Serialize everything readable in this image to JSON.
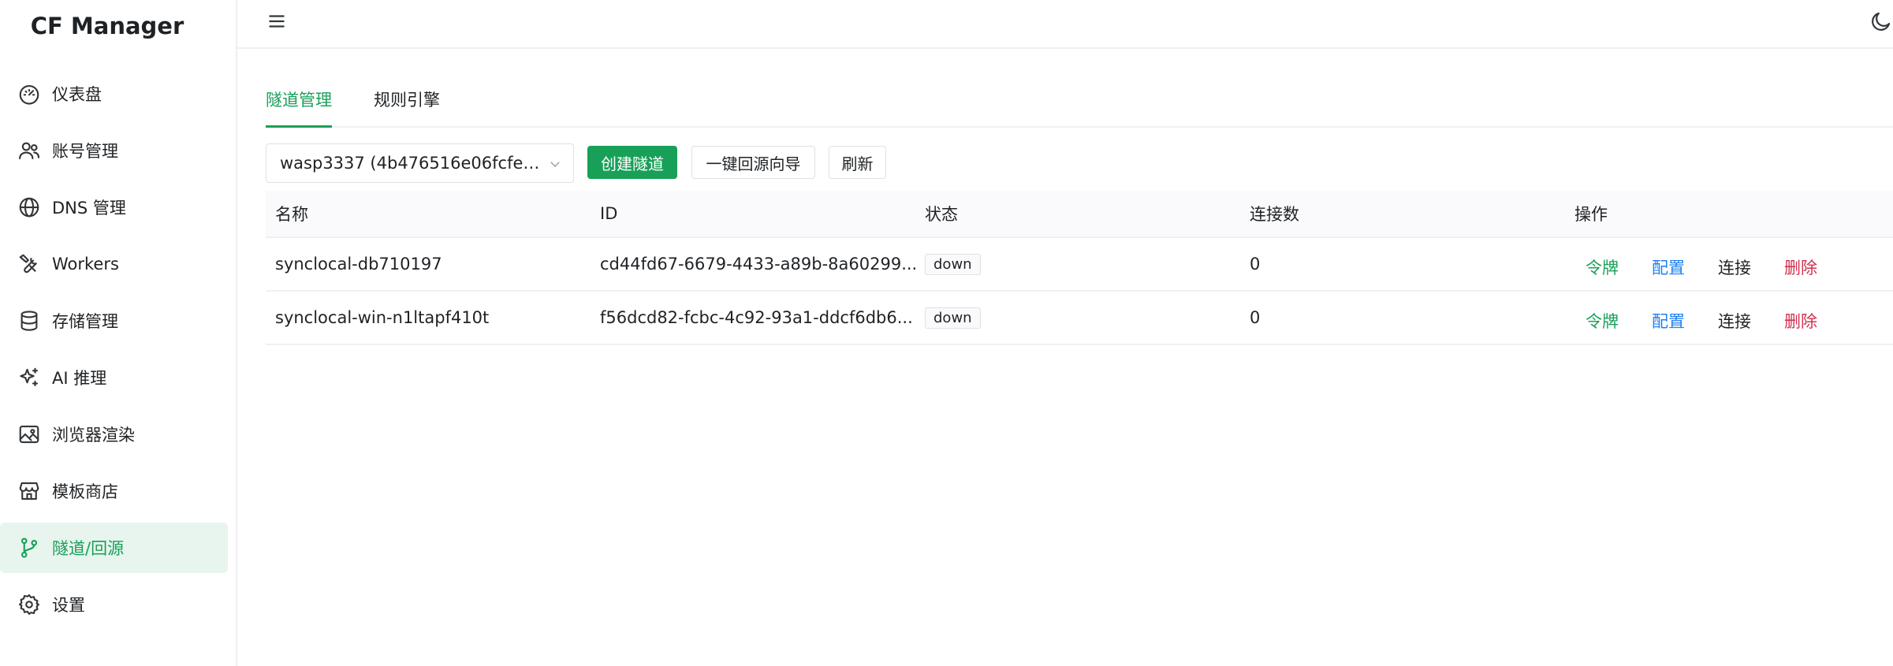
{
  "app": {
    "title": "CF Manager"
  },
  "sidebar": {
    "items": [
      {
        "label": "仪表盘",
        "icon": "dashboard-icon"
      },
      {
        "label": "账号管理",
        "icon": "users-icon"
      },
      {
        "label": "DNS 管理",
        "icon": "globe-icon"
      },
      {
        "label": "Workers",
        "icon": "tools-icon"
      },
      {
        "label": "存储管理",
        "icon": "database-icon"
      },
      {
        "label": "AI 推理",
        "icon": "sparkles-icon"
      },
      {
        "label": "浏览器渲染",
        "icon": "image-icon"
      },
      {
        "label": "模板商店",
        "icon": "store-icon"
      },
      {
        "label": "隧道/回源",
        "icon": "git-branch-icon",
        "active": true
      },
      {
        "label": "设置",
        "icon": "gear-icon"
      }
    ]
  },
  "tabs": [
    {
      "label": "隧道管理",
      "active": true
    },
    {
      "label": "规则引擎",
      "active": false
    }
  ],
  "toolbar": {
    "account_select": "wasp3337 (4b476516e06fcfe92...",
    "create_label": "创建隧道",
    "wizard_label": "一键回源向导",
    "refresh_label": "刷新"
  },
  "table": {
    "headers": [
      "名称",
      "ID",
      "状态",
      "连接数",
      "操作"
    ],
    "rows": [
      {
        "name": "synclocal-db710197",
        "id": "cd44fd67-6679-4433-a89b-8a60299...",
        "status": "down",
        "connections": "0"
      },
      {
        "name": "synclocal-win-n1ltapf410t",
        "id": "f56dcd82-fcbc-4c92-93a1-ddcf6db6...",
        "status": "down",
        "connections": "0"
      }
    ],
    "actions": {
      "token": "令牌",
      "config": "配置",
      "connect": "连接",
      "delete": "删除"
    }
  },
  "colors": {
    "accent": "#18a058",
    "link": "#2080f0",
    "danger": "#d03050"
  }
}
